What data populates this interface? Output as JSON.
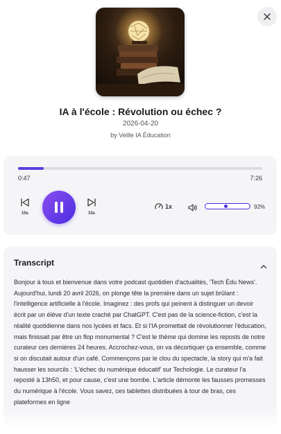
{
  "episode": {
    "title": "IA à l'école : Révolution ou échec ?",
    "date": "2026-04-20",
    "author": "by Veille IA Éducation"
  },
  "player": {
    "current_time": "0:47",
    "total_time": "7:26",
    "progress": 0.105,
    "skip_back_label": "15s",
    "skip_forward_label": "15s",
    "state": "playing",
    "speed": "1x",
    "volume_label": "92%",
    "volume": 0.92,
    "accent_color": "#5b3fe0"
  },
  "icons": {
    "close": "close-icon",
    "skip_back": "skip-back-icon",
    "skip_forward": "skip-forward-icon",
    "pause": "pause-icon",
    "speed": "speedometer-icon",
    "volume": "volume-icon",
    "collapse": "chevron-up-icon"
  },
  "transcript": {
    "heading": "Transcript",
    "text": "Bonjour à tous et bienvenue dans votre podcast quotidien d'actualités, 'Tech Édu News'. Aujourd'hui, lundi 20 avril 2026, on plonge tête la première dans un sujet brûlant : l'intelligence artificielle à l'école. Imaginez : des profs qui peinent à distinguer un devoir écrit par un élève d'un texte craché par ChatGPT. C'est pas de la science-fiction, c'est la réalité quotidienne dans nos lycées et facs. Et si l'IA promettait de révolutionner l'éducation, mais finissait par être un flop monumental ? C'est le thème qui domine les reposts de notre curateur ces dernières 24 heures. Accrochez-vous, on va décortiquer ça ensemble, comme si on discutait autour d'un café. Commençons par le clou du spectacle, la story qui m'a fait hausser les sourcils : 'L'échec du numérique éducatif' sur Techologie. Le curateur l'a reposté à 13h50, et pour cause, c'est une bombe. L'article démonte les fausses promesses du numérique à l'école. Vous savez, ces tablettes distribuées à tour de bras, ces plateformes en ligne"
  }
}
